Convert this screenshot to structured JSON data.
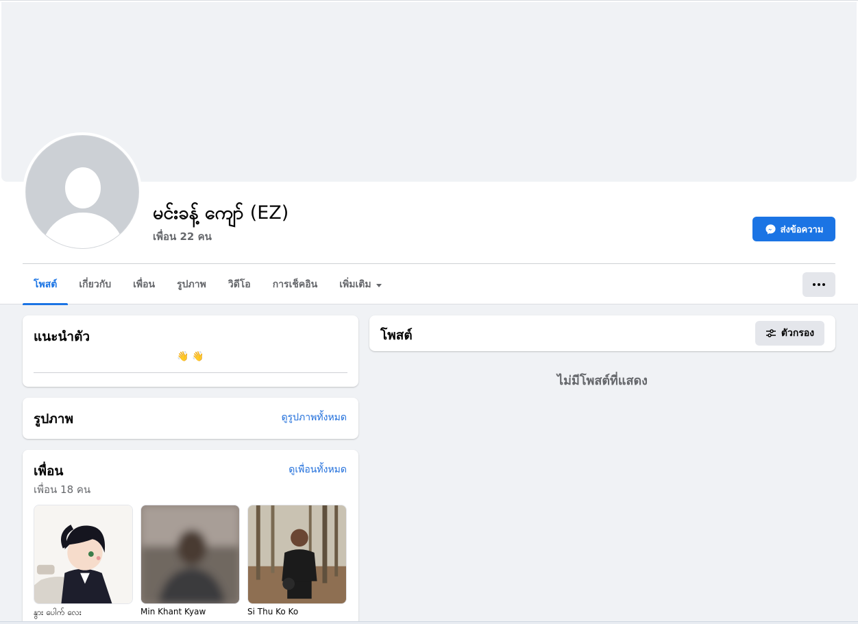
{
  "profile": {
    "name": "မင်းခန့် ကျော်",
    "alt_name": "(EZ)",
    "friend_count": "เพื่อน 22 คน"
  },
  "actions": {
    "message_label": "ส่งข้อความ"
  },
  "tabs": [
    {
      "label": "โพสต์",
      "active": true
    },
    {
      "label": "เกี่ยวกับ"
    },
    {
      "label": "เพื่อน"
    },
    {
      "label": "รูปภาพ"
    },
    {
      "label": "วิดีโอ"
    },
    {
      "label": "การเช็คอิน"
    },
    {
      "label": "เพิ่มเติม"
    }
  ],
  "intro": {
    "title": "แนะนำตัว",
    "bio": "👋 👋"
  },
  "photos": {
    "title": "รูปภาพ",
    "see_all": "ดูรูปภาพทั้งหมด"
  },
  "friends": {
    "title": "เพื่อน",
    "see_all": "ดูเพื่อนทั้งหมด",
    "subtitle": "เพื่อน 18 คน",
    "items": [
      {
        "name": "နွား ပေါက် လေး"
      },
      {
        "name": "Min Khant Kyaw"
      },
      {
        "name": "Si Thu Ko Ko"
      }
    ]
  },
  "posts": {
    "title": "โพสต์",
    "filter_label": "ตัวกรอง",
    "empty_text": "ไม่มีโพสต์ที่แสดง"
  },
  "colors": {
    "accent": "#1b74e4",
    "page_bg": "#f0f2f5",
    "secondary_text": "#65676b"
  }
}
